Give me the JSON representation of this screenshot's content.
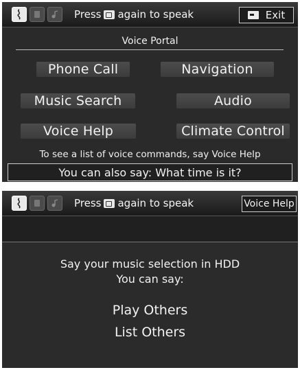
{
  "screen1": {
    "status_text_before": "Press",
    "status_text_after": "again to speak",
    "exit_label": "Exit",
    "title": "Voice Portal",
    "commands": [
      "Phone Call",
      "Navigation",
      "Music Search",
      "Audio",
      "Voice Help",
      "Climate Control"
    ],
    "hint": "To see a list of voice commands, say Voice Help",
    "also_say": "You can also say: What time is it?"
  },
  "screen2": {
    "status_text_before": "Press",
    "status_text_after": "again to speak",
    "voice_help_label": "Voice Help",
    "prompt_line1": "Say your music selection in HDD",
    "prompt_line2": "You can say:",
    "options": [
      "Play Others",
      "List Others"
    ]
  },
  "icons": {
    "status": [
      "voice-active-icon",
      "phone-voice-icon",
      "music-voice-icon"
    ],
    "talk": "talk-button-icon",
    "back": "back-icon"
  },
  "colors": {
    "background": "#2a2a2a",
    "text": "#f2f2f2",
    "button": "#444444"
  }
}
